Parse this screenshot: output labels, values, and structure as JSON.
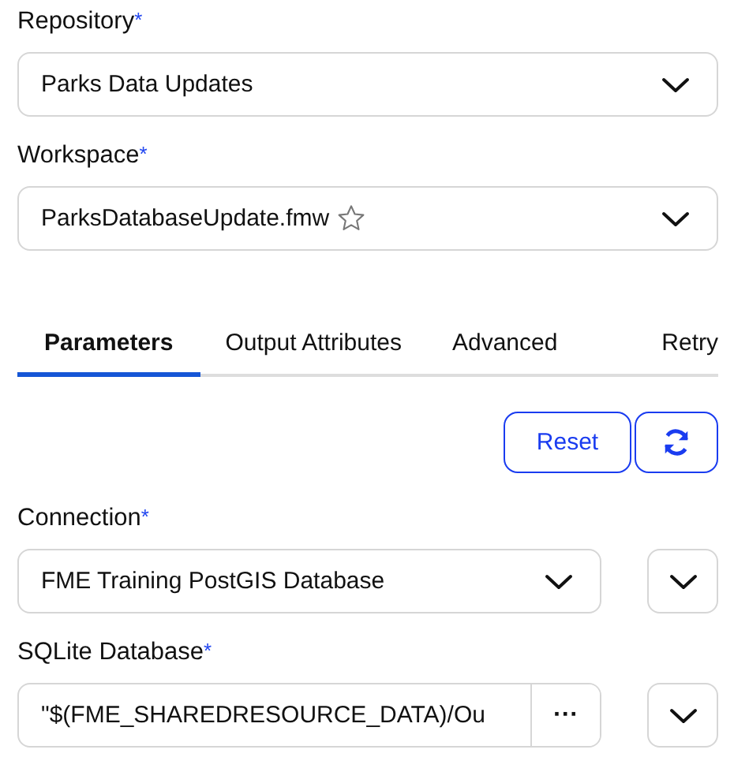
{
  "top_fields": [
    {
      "label": "Repository",
      "required_mark": "*",
      "value": "Parks Data Updates",
      "favorite": false
    },
    {
      "label": "Workspace",
      "required_mark": "*",
      "value": "ParksDatabaseUpdate.fmw",
      "favorite": true
    }
  ],
  "tabs": [
    {
      "label": "Parameters",
      "selected": true
    },
    {
      "label": "Output Attributes",
      "selected": false
    },
    {
      "label": "Advanced",
      "selected": false
    },
    {
      "label": "Retry",
      "selected": false
    }
  ],
  "actions": {
    "reset": "Reset"
  },
  "parameters": [
    {
      "kind": "select",
      "label": "Connection",
      "required_mark": "*",
      "value": "FME Training PostGIS Database"
    },
    {
      "kind": "browse",
      "label": "SQLite Database",
      "required_mark": "*",
      "value": "\"$(FME_SHAREDRESOURCE_DATA)/Ou",
      "browse_label": "···"
    }
  ]
}
